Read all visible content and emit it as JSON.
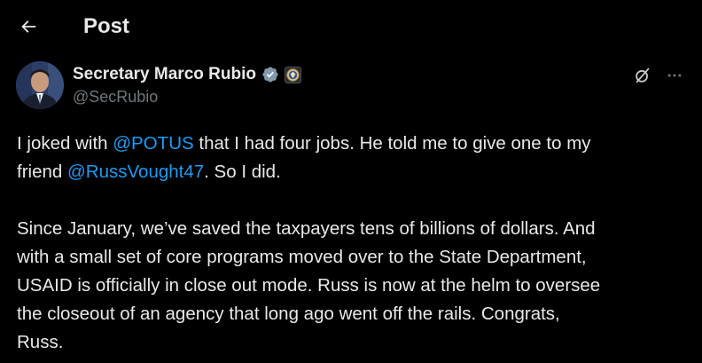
{
  "header": {
    "title": "Post",
    "back_icon": "arrow-left-icon"
  },
  "author": {
    "display_name": "Secretary Marco Rubio",
    "handle": "@SecRubio",
    "verified_badge_color": "#829aab",
    "affiliation_icon": "state-department-seal-icon"
  },
  "actions": {
    "grok_icon": "grok-icon",
    "more_icon": "more-icon"
  },
  "tweet": {
    "p1_a": "I joked with ",
    "mention1": "@POTUS",
    "p1_b": " that I had four jobs. He told me to give one to my",
    "p1_c": "friend ",
    "mention2": "@RussVought47",
    "p1_d": ". So I did.",
    "p2_1": "Since January, we’ve saved the taxpayers tens of billions of dollars. And",
    "p2_2": "with a small set of core programs moved over to the State Department,",
    "p2_3": "USAID is officially in close out mode. Russ is now at the helm to oversee",
    "p2_4": "the closeout of an agency that long ago went off the rails. Congrats,",
    "p2_5": "Russ."
  },
  "colors": {
    "background": "#000000",
    "text": "#e7e9ea",
    "secondary_text": "#71767b",
    "link": "#1d9bf0"
  }
}
